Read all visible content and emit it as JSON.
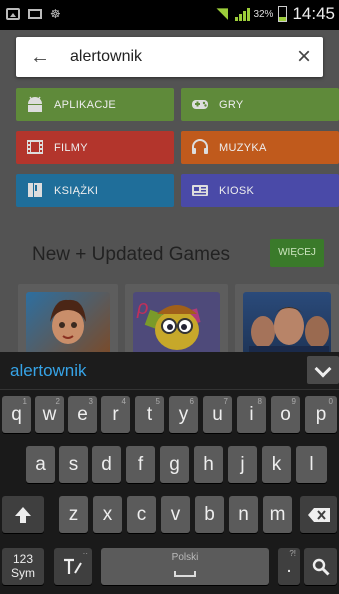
{
  "status_bar": {
    "icons_left": [
      "gallery-icon",
      "mail-icon",
      "android-debug-icon"
    ],
    "battery_percent": "32%",
    "battery_level": 0.32,
    "time": "14:45"
  },
  "search": {
    "query": "alertownik"
  },
  "categories": [
    {
      "label": "APLIKACJE",
      "icon": "android-icon",
      "color": "#5f8a3a"
    },
    {
      "label": "GRY",
      "icon": "gamepad-icon",
      "color": "#5f8a3a"
    },
    {
      "label": "FILMY",
      "icon": "film-icon",
      "color": "#b3352c"
    },
    {
      "label": "MUZYKA",
      "icon": "headphones-icon",
      "color": "#c05a1c"
    },
    {
      "label": "KSIĄŻKI",
      "icon": "book-icon",
      "color": "#1f6e9a"
    },
    {
      "label": "KIOSK",
      "icon": "newsstand-icon",
      "color": "#4a4aa8"
    }
  ],
  "section": {
    "title": "New + Updated Games",
    "more_label": "WIĘCEJ"
  },
  "keyboard": {
    "suggestion": "alertownik",
    "row1": [
      {
        "k": "q",
        "sub": "1"
      },
      {
        "k": "w",
        "sub": "2"
      },
      {
        "k": "e",
        "sub": "3"
      },
      {
        "k": "r",
        "sub": "4"
      },
      {
        "k": "t",
        "sub": "5"
      },
      {
        "k": "y",
        "sub": "6"
      },
      {
        "k": "u",
        "sub": "7"
      },
      {
        "k": "i",
        "sub": "8"
      },
      {
        "k": "o",
        "sub": "9"
      },
      {
        "k": "p",
        "sub": "0"
      }
    ],
    "row2": [
      "a",
      "s",
      "d",
      "f",
      "g",
      "h",
      "j",
      "k",
      "l"
    ],
    "row3": [
      "z",
      "x",
      "c",
      "v",
      "b",
      "n",
      "m"
    ],
    "sym_label_top": "123",
    "sym_label_bottom": "Sym",
    "space_label": "Polski",
    "period": ".",
    "period_sub": "?!"
  }
}
